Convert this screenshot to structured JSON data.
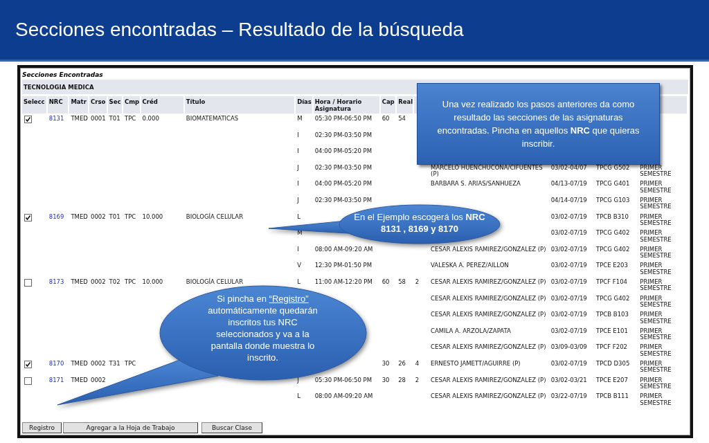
{
  "slide": {
    "title": "Secciones encontradas – Resultado de la búsqueda"
  },
  "panel": {
    "heading": "Secciones Encontradas",
    "group": "TECNOLOGIA MEDICA",
    "columns": [
      "Selecc",
      "NRC",
      "Matr",
      "Crso",
      "Sec",
      "Cmp",
      "Créd",
      "Título",
      "Días",
      "Hora / Horario Asignatura",
      "Cap",
      "Real"
    ],
    "rows": [
      {
        "selected": true,
        "nrc": "8131",
        "matr": "TMED",
        "crso": "0001",
        "sec": "T01",
        "cmp": "TPC",
        "cred": "0.000",
        "titulo": "BIOMATEMATICAS",
        "dias": "M",
        "hora": "05:30 PM-06:50 PM",
        "cap": "60",
        "real": "54"
      },
      {
        "dias": "I",
        "hora": "02:30 PM-03:50 PM"
      },
      {
        "dias": "I",
        "hora": "04:00 PM-05:20 PM"
      },
      {
        "dias": "J",
        "hora": "02:30 PM-03:50 PM",
        "column_14": "MARCELO HUENCHUCONA/CIFUENTES (P)",
        "column_15": "03/02-04/07",
        "column_16": "TPCG G502",
        "column_17": "PRIMER SEMESTRE"
      },
      {
        "dias": "I",
        "hora": "04:00 PM-05:20 PM",
        "column_14": "BARBARA S. ARIAS/SANHUEZA",
        "column_15": "04/13-07/19",
        "column_16": "TPCG G401",
        "column_17": "PRIMER SEMESTRE"
      },
      {
        "dias": "J",
        "hora": "02:30 PM-03:50 PM",
        "column_15": "04/14-07/19",
        "column_16": "TPCG G103",
        "column_17": "PRIMER SEMESTRE"
      },
      {
        "selected": true,
        "nrc": "8169",
        "matr": "TMED",
        "crso": "0002",
        "sec": "T01",
        "cmp": "TPC",
        "cred": "10.000",
        "titulo": "BIOLOGÍA CELULAR",
        "dias": "L",
        "column_15": "03/02-07/19",
        "column_16": "TPCB B310",
        "column_17": "PRIMER SEMESTRE"
      },
      {
        "dias": "M",
        "column_15": "03/02-07/19",
        "column_16": "TPCG G402",
        "column_17": "PRIMER SEMESTRE"
      },
      {
        "dias": "I",
        "hora": "08:00 AM-09:20 AM",
        "column_14": "CESAR ALEXIS RAMIREZ/GONZALEZ (P)",
        "column_15": "03/02-07/19",
        "column_16": "TPCG G402",
        "column_17": "PRIMER SEMESTRE"
      },
      {
        "dias": "V",
        "hora": "12:30 PM-01:50 PM",
        "column_14": "VALESKA A. PEREZ/AILLON",
        "column_15": "03/02-07/19",
        "column_16": "TPCE E203",
        "column_17": "PRIMER SEMESTRE"
      },
      {
        "selected": false,
        "nrc": "8173",
        "matr": "TMED",
        "crso": "0002",
        "sec": "T02",
        "cmp": "TPC",
        "cred": "10.000",
        "titulo": "BIOLOGÍA CELULAR",
        "dias": "L",
        "hora": "11:00 AM-12:20 PM",
        "cap": "60",
        "real": "58",
        "column_13": "2",
        "column_14": "CESAR ALEXIS RAMIREZ/GONZALEZ (P)",
        "column_15": "03/02-07/19",
        "column_16": "TPCF F104",
        "column_17": "PRIMER SEMESTRE"
      },
      {
        "column_14": "CESAR ALEXIS RAMIREZ/GONZALEZ (P)",
        "column_15": "03/02-07/19",
        "column_16": "TPCG G402",
        "column_17": "PRIMER SEMESTRE"
      },
      {
        "column_14": "CESAR ALEXIS RAMIREZ/GONZALEZ (P)",
        "column_15": "03/02-07/19",
        "column_16": "TPCB B103",
        "column_17": "PRIMER SEMESTRE"
      },
      {
        "column_14": "CAMILA A. ARZOLA/ZAPATA",
        "column_15": "03/02-07/19",
        "column_16": "TPCE E101",
        "column_17": "PRIMER SEMESTRE"
      },
      {
        "column_14": "CESAR ALEXIS RAMIREZ/GONZALEZ (P)",
        "column_15": "03/09-03/09",
        "column_16": "TPCF F202",
        "column_17": "PRIMER SEMESTRE"
      },
      {
        "selected": true,
        "nrc": "8170",
        "matr": "TMED",
        "crso": "0002",
        "sec": "T31",
        "cmp": "TPC",
        "cap": "30",
        "real": "26",
        "column_13": "4",
        "column_14": "ERNESTO JAMETT/AGUIRRE (P)",
        "column_15": "03/02-07/19",
        "column_16": "TPCD D305",
        "column_17": "PRIMER SEMESTRE"
      },
      {
        "selected": false,
        "nrc": "8171",
        "matr": "TMED",
        "crso": "0002",
        "dias": "J",
        "hora": "05:30 PM-06:50 PM",
        "cap": "30",
        "real": "28",
        "column_13": "2",
        "column_14": "CESAR ALEXIS RAMIREZ/GONZALEZ (P)",
        "column_15": "03/02-03/21",
        "column_16": "TPCE E207",
        "column_17": "PRIMER SEMESTRE"
      },
      {
        "dias": "L",
        "hora": "08:00 AM-09:20 AM",
        "column_14": "CESAR ALEXIS RAMIREZ/GONZALEZ (P)",
        "column_15": "03/22-07/19",
        "column_16": "TPCB B111",
        "column_17": "PRIMER SEMESTRE"
      }
    ]
  },
  "buttons": [
    "Registro",
    "Agregar a la Hoja de Trabajo",
    "Buscar Clase"
  ],
  "callouts": [
    {
      "kind": "box",
      "text": "Una vez realizado los pasos anteriores da como resultado las secciones de las asignaturas encontradas. Pincha en aquellos **NRC** que quieras inscribir."
    },
    {
      "kind": "oval",
      "text": "En el Ejemplo escogerá los **NRC 8131 , 8169 y 8170**"
    },
    {
      "kind": "oval_link",
      "prefix": "Si pincha en",
      "link": "“Registro”",
      "text": "automáticamente quedarán inscritos tus NRC seleccionados y va a la pantalla donde muestra lo inscrito."
    }
  ]
}
